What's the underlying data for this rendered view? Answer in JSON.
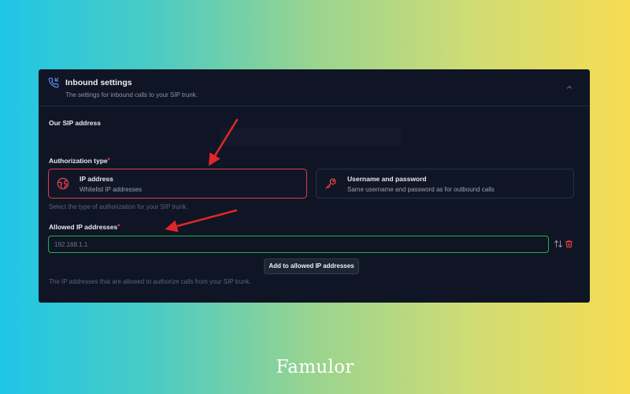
{
  "header": {
    "title": "Inbound settings",
    "subtitle": "The settings for inbound calls to your SIP trunk.",
    "icon": "phone-incoming-icon",
    "collapse_icon": "chevron-up-icon"
  },
  "sip_address": {
    "label": "Our SIP address"
  },
  "authorization": {
    "label": "Authorization type",
    "required_mark": "*",
    "options": [
      {
        "title": "IP address",
        "description": "Whitelist IP addresses",
        "icon": "globe-icon",
        "selected": true
      },
      {
        "title": "Username and password",
        "description": "Same username and password as for outbound calls",
        "icon": "key-icon",
        "selected": false
      }
    ],
    "help": "Select the type of authorization for your SIP trunk."
  },
  "allowed_ips": {
    "label": "Allowed IP addresses",
    "required_mark": "*",
    "input_value": "",
    "input_placeholder": "192.168.1.1",
    "add_button": "Add to allowed IP addresses",
    "help": "The IP addresses that are allowed to authorize calls from your SIP trunk."
  },
  "brand": {
    "name": "Famulor"
  },
  "colors": {
    "panel_bg": "#0f1524",
    "selected_border": "#dc3f4a",
    "input_border": "#22b14c",
    "annotation_arrow": "#e0262b"
  }
}
